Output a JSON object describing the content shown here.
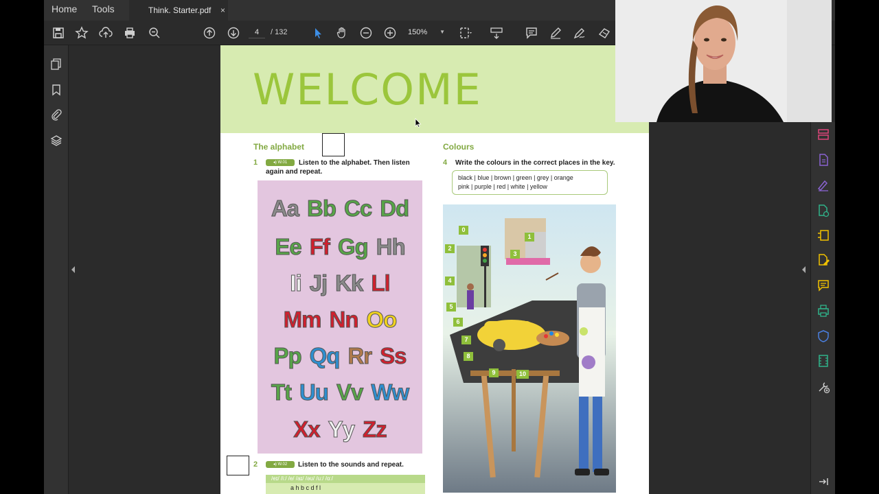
{
  "menu": {
    "home": "Home",
    "tools": "Tools",
    "tab_title": "Think. Starter.pdf",
    "tab_close": "×"
  },
  "toolbar": {
    "current_page": "4",
    "page_separator": "/ 132",
    "zoom": "150%",
    "icons": [
      "save-icon",
      "star-icon",
      "upload-icon",
      "print-icon",
      "zoom-out-magnifier-icon",
      "page-up-icon",
      "page-down-icon",
      "select-cursor-icon",
      "hand-icon",
      "zoom-out-icon",
      "zoom-in-icon",
      "fit-page-icon",
      "scroll-mode-icon",
      "comment-icon",
      "pen-icon",
      "sign-icon",
      "share-icon"
    ]
  },
  "left_rail": {
    "icons": [
      "pages-icon",
      "bookmark-icon",
      "attachment-icon",
      "layers-icon"
    ]
  },
  "right_rail": {
    "icons": [
      "organize-pages-icon",
      "export-pdf-icon",
      "fill-sign-icon",
      "create-pdf-icon",
      "compress-icon",
      "edit-pdf-icon",
      "comment-icon",
      "print-production-icon",
      "protect-icon",
      "rich-media-icon",
      "more-tools-icon",
      "collapse-panel-icon"
    ]
  },
  "page": {
    "banner_title": "WELCOME",
    "alphabet": {
      "heading": "The alphabet",
      "ex1_num": "1",
      "ex1_badge": "W.01",
      "ex1_text": "Listen to the alphabet. Then listen again and repeat.",
      "rows": [
        [
          {
            "t": "Aa",
            "c": "#8a8a8a"
          },
          {
            "t": "Bb",
            "c": "#58a548"
          },
          {
            "t": "Cc",
            "c": "#58a548"
          },
          {
            "t": "Dd",
            "c": "#58a548"
          }
        ],
        [
          {
            "t": "Ee",
            "c": "#58a548"
          },
          {
            "t": "Ff",
            "c": "#d0202e"
          },
          {
            "t": "Gg",
            "c": "#58a548"
          },
          {
            "t": "Hh",
            "c": "#8a8a8a"
          }
        ],
        [
          {
            "t": "Ii",
            "c": "#f2f2f2"
          },
          {
            "t": "Jj",
            "c": "#8a8a8a"
          },
          {
            "t": "Kk",
            "c": "#8a8a8a"
          },
          {
            "t": "Ll",
            "c": "#d0202e"
          }
        ],
        [
          {
            "t": "Mm",
            "c": "#d0202e"
          },
          {
            "t": "Nn",
            "c": "#d0202e"
          },
          {
            "t": "Oo",
            "c": "#f1d21f"
          }
        ],
        [
          {
            "t": "Pp",
            "c": "#58a548"
          },
          {
            "t": "Qq",
            "c": "#2f8fd0"
          },
          {
            "t": "Rr",
            "c": "#b07a4c"
          },
          {
            "t": "Ss",
            "c": "#d0202e"
          }
        ],
        [
          {
            "t": "Tt",
            "c": "#58a548"
          },
          {
            "t": "Uu",
            "c": "#2f8fd0"
          },
          {
            "t": "Vv",
            "c": "#58a548"
          },
          {
            "t": "Ww",
            "c": "#2f8fd0"
          }
        ],
        [
          {
            "t": "Xx",
            "c": "#d0202e"
          },
          {
            "t": "Yy",
            "c": "#f2f2f2"
          },
          {
            "t": "Zz",
            "c": "#d0202e"
          }
        ]
      ],
      "ex2_num": "2",
      "ex2_badge": "W.02",
      "ex2_text": "Listen to the sounds and repeat.",
      "phon_head": "/eɪ/   /iː/   /e/   /aɪ/   /əʊ/   /uː/   /ɑː/",
      "phon_row": "a h    b c d    f l"
    },
    "colours": {
      "heading": "Colours",
      "ex4_num": "4",
      "ex4_text": "Write the colours in the correct places in the key.",
      "key_line1": "black  |  blue  |  brown  |  green  |  grey  |  orange",
      "key_line2": "pink  |  purple  |  red  |  white  |  yellow",
      "labels": [
        "0",
        "1",
        "2",
        "3",
        "4",
        "5",
        "6",
        "7",
        "8",
        "9",
        "10"
      ]
    }
  },
  "colors": {
    "banner_bg": "#d7ebb1",
    "banner_text": "#9bc63c",
    "accent_green": "#82a942",
    "card_pink": "#e3c6df",
    "app_bg": "#2b2b2b"
  }
}
